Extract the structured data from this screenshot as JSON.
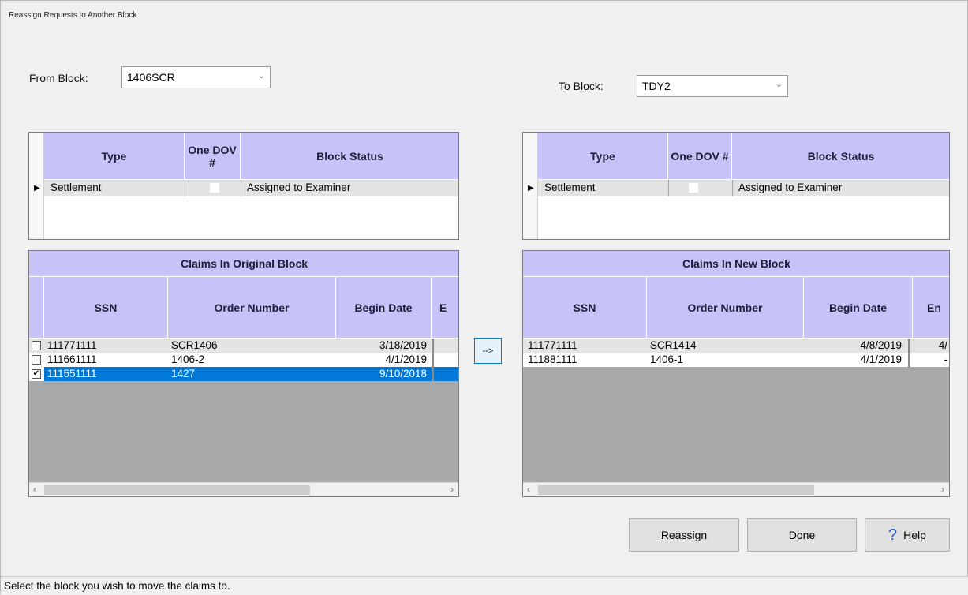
{
  "window": {
    "title": "Reassign Requests to Another Block"
  },
  "from_block": {
    "label": "From Block:",
    "value": "1406SCR"
  },
  "to_block": {
    "label": "To Block:",
    "value": "TDY2"
  },
  "block_grid": {
    "headers": {
      "type": "Type",
      "one_dov": "One DOV #",
      "block_status": "Block Status"
    },
    "left_row": {
      "type": "Settlement",
      "block_status": "Assigned to Examiner"
    },
    "right_row": {
      "type": "Settlement",
      "block_status": "Assigned to Examiner"
    }
  },
  "claims_original": {
    "title": "Claims In Original Block",
    "headers": {
      "ssn": "SSN",
      "order_number": "Order Number",
      "begin_date": "Begin Date",
      "end_date_partial": "E"
    },
    "rows": [
      {
        "ssn": "111771111",
        "order_number": "SCR1406",
        "begin_date": "3/18/2019",
        "checked": false
      },
      {
        "ssn": "111661111",
        "order_number": "1406-2",
        "begin_date": "4/1/2019",
        "checked": false
      },
      {
        "ssn": "111551111",
        "order_number": "1427",
        "begin_date": "9/10/2018",
        "checked": true
      }
    ]
  },
  "claims_new": {
    "title": "Claims In New Block",
    "headers": {
      "ssn": "SSN",
      "order_number": "Order Number",
      "begin_date": "Begin Date",
      "end_date_partial": "En"
    },
    "rows": [
      {
        "ssn": "111771111",
        "order_number": "SCR1414",
        "begin_date": "4/8/2019",
        "end_partial": "4/"
      },
      {
        "ssn": "111881111",
        "order_number": "1406-1",
        "begin_date": "4/1/2019",
        "end_partial": "-"
      }
    ]
  },
  "move_button": {
    "label": "-->"
  },
  "buttons": {
    "reassign": "Reassign",
    "done": "Done",
    "help": "Help",
    "help_icon": "?"
  },
  "status_bar": {
    "text": "Select the block you wish to move the claims to."
  },
  "icons": {
    "row_pointer": "row-pointer-icon",
    "dropdown": "chevron-down-icon"
  },
  "colors": {
    "header_bg": "#c7c3f8",
    "selection": "#0078d7",
    "empty_grid": "#a8a8a8"
  }
}
